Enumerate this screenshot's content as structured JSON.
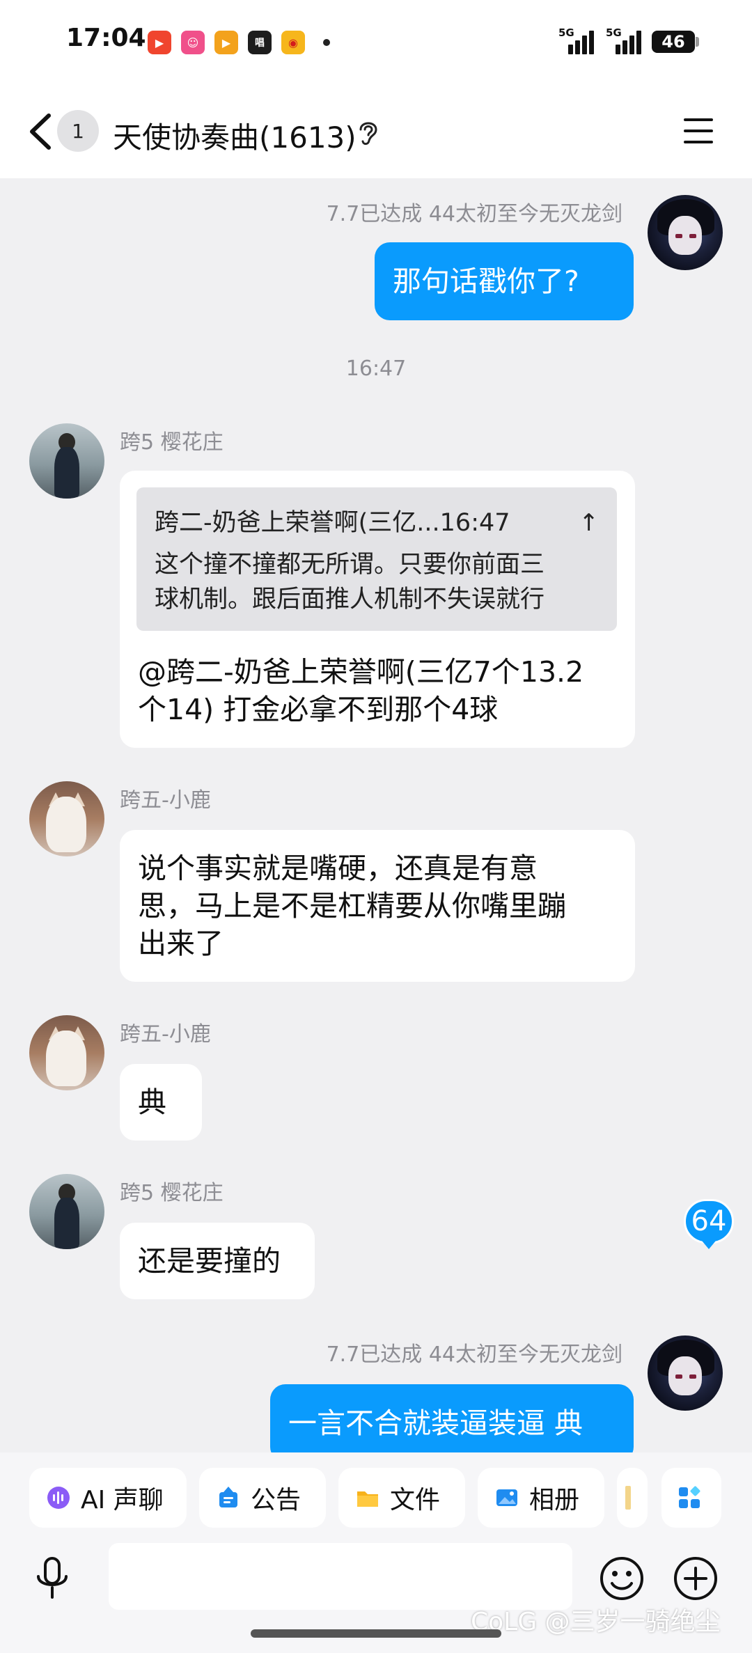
{
  "status_bar": {
    "time": "17:04",
    "apps": [
      {
        "icon": "video-app-icon",
        "glyph": "▶",
        "color": "#f0452e"
      },
      {
        "icon": "pink-face-app-icon",
        "glyph": "☺",
        "color": "#f0508a"
      },
      {
        "icon": "green-video-app-icon",
        "glyph": "▶",
        "color": "#f3a21c"
      },
      {
        "icon": "text-app-icon",
        "glyph": "唱",
        "color": "#1d1d1d"
      },
      {
        "icon": "weibo-icon",
        "glyph": "◉",
        "color": "#f6b61c"
      }
    ],
    "signal_label_1": "5G",
    "signal_label_2": "5G",
    "battery": "46"
  },
  "header": {
    "unread_count": "1",
    "title": "天使协奏曲(1613)"
  },
  "messages": {
    "m1_sender": "7.7已达成   44太初至今无灭龙剑",
    "m1_text": "那句话戳你了?",
    "time_sep": "16:47",
    "m2_sender": "跨5 樱花庄",
    "m2_quote_header": "跨二-奶爸上荣誉啊(三亿...16:47",
    "m2_quote_line1": "这个撞不撞都无所谓。只要你前面三",
    "m2_quote_line2": "球机制。跟后面推人机制不失误就行",
    "m2_line1": "@跨二-奶爸上荣誉啊(三亿7个13.2",
    "m2_line2": "个14) 打金必拿不到那个4球",
    "m3_sender": "跨五-小鹿",
    "m3_line1": "说个事实就是嘴硬，还真是有意",
    "m3_line2": "思，马上是不是杠精要从你嘴里蹦",
    "m3_line3": "出来了",
    "m4_sender": "跨五-小鹿",
    "m4_text": "典",
    "m5_sender": "跨5 樱花庄",
    "m5_text": "还是要撞的",
    "m6_sender": "7.7已达成   44太初至今无灭龙剑",
    "m6_text": "一言不合就装逼装逼 典",
    "unread_badge": "64"
  },
  "quick_actions": {
    "ai_voice": "AI 声聊",
    "notice": "公告",
    "files": "文件",
    "album": "相册"
  },
  "watermark": "CoLG @三岁一骑绝尘",
  "colors": {
    "self_bubble": "#0a9bfd",
    "other_bubble": "#ffffff",
    "background": "#f0f0f2"
  }
}
